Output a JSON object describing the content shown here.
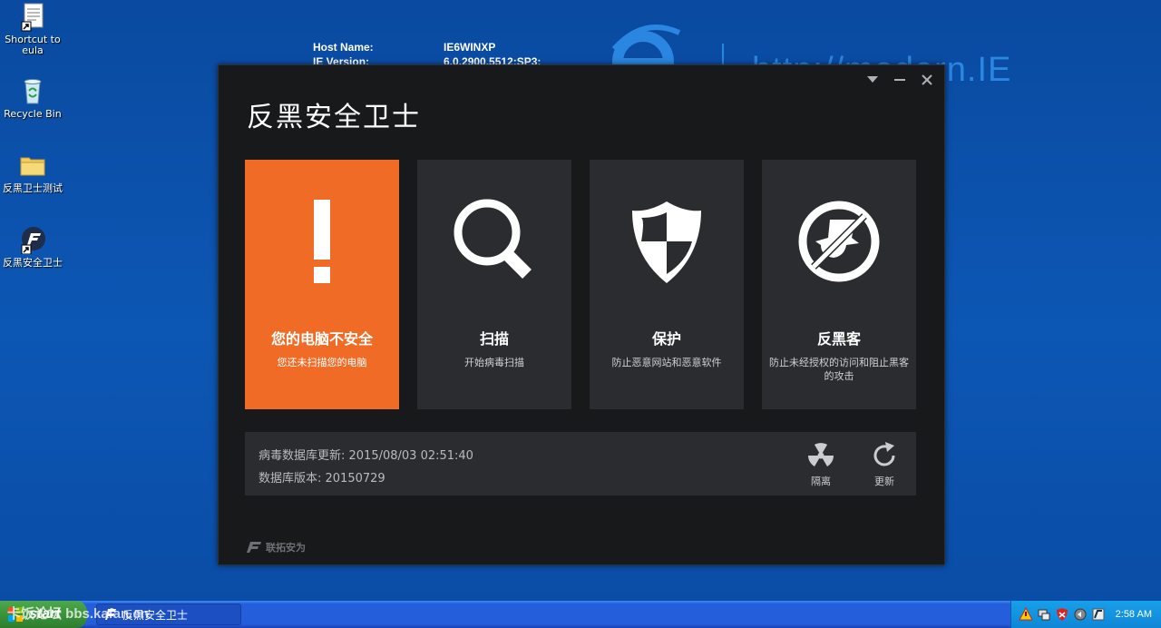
{
  "desktop": {
    "icons": [
      {
        "label": "Shortcut to eula"
      },
      {
        "label": "Recycle Bin"
      },
      {
        "label": "反黑卫士测试"
      },
      {
        "label": "反黑安全卫士"
      }
    ],
    "sysinfo": [
      {
        "key": "Host Name:",
        "value": "IE6WINXP"
      },
      {
        "key": "IE Version:",
        "value": "6.0.2900.5512:SP3:"
      }
    ],
    "brand_url": "http://modern.IE"
  },
  "app": {
    "title": "反黑安全卫士",
    "controls": {
      "menu": "menu-icon",
      "minimize": "minimize-icon",
      "close": "close-icon"
    },
    "tiles": [
      {
        "title": "您的电脑不安全",
        "desc": "您还未扫描您的电脑",
        "icon": "exclamation-icon"
      },
      {
        "title": "扫描",
        "desc": "开始病毒扫描",
        "icon": "magnifier-icon"
      },
      {
        "title": "保护",
        "desc": "防止恶意网站和恶意软件",
        "icon": "shield-icon"
      },
      {
        "title": "反黑客",
        "desc": "防止未经授权的访问和阻止黑客的攻击",
        "icon": "no-hacker-icon"
      }
    ],
    "info": {
      "db_update": "病毒数据库更新: 2015/08/03 02:51:40",
      "db_version": "数据库版本: 20150729",
      "quarantine": "隔离",
      "update": "更新"
    },
    "footer": "联拓安为",
    "colors": {
      "alert": "#f06b25",
      "tile": "#2a2c2f",
      "window": "#18191b"
    }
  },
  "taskbar": {
    "start": "start",
    "watermark": "卡饭论坛 bbs.kafan.cn",
    "task": "反黑安全卫士",
    "clock": "2:58 AM"
  }
}
